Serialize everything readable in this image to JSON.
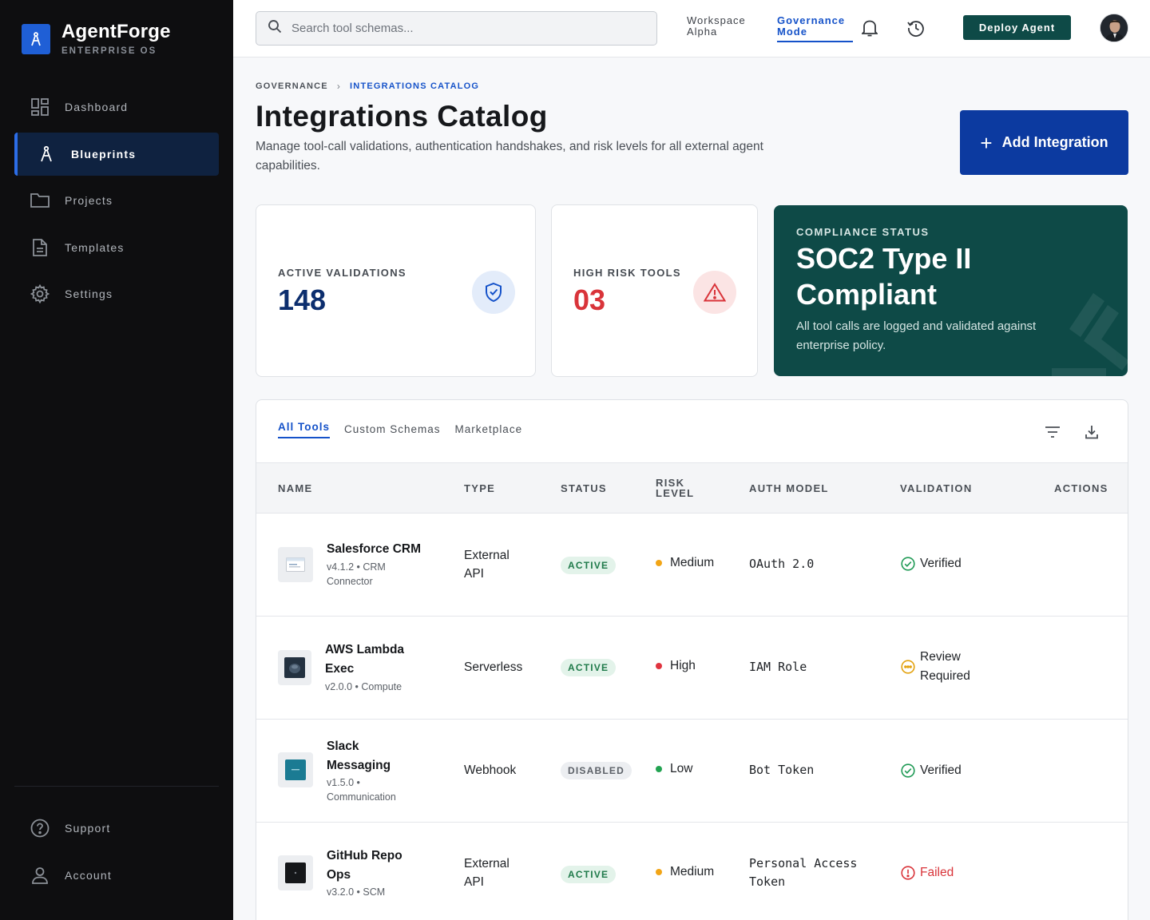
{
  "brand": {
    "name": "AgentForge",
    "subtitle": "ENTERPRISE OS"
  },
  "sidebar": {
    "items": [
      {
        "label": "Dashboard",
        "icon": "dashboard-grid-icon",
        "active": false
      },
      {
        "label": "Blueprints",
        "icon": "compass-icon",
        "active": true
      },
      {
        "label": "Projects",
        "icon": "folder-icon",
        "active": false
      },
      {
        "label": "Templates",
        "icon": "document-icon",
        "active": false
      },
      {
        "label": "Settings",
        "icon": "gear-icon",
        "active": false
      }
    ],
    "bottom": [
      {
        "label": "Support",
        "icon": "help-circle-icon"
      },
      {
        "label": "Account",
        "icon": "user-icon"
      }
    ]
  },
  "topbar": {
    "search_placeholder": "Search tool schemas...",
    "workspace": "Workspace Alpha",
    "governance": "Governance Mode",
    "deploy_label": "Deploy Agent",
    "icons": [
      "bell-icon",
      "history-icon"
    ]
  },
  "breadcrumb": {
    "parent": "GOVERNANCE",
    "current": "INTEGRATIONS CATALOG"
  },
  "page": {
    "title": "Integrations Catalog",
    "description": "Manage tool-call validations, authentication handshakes, and risk levels for all external agent capabilities.",
    "add_label": "Add Integration"
  },
  "stats": {
    "active_validations": {
      "label": "ACTIVE VALIDATIONS",
      "value": "148"
    },
    "high_risk": {
      "label": "HIGH RISK TOOLS",
      "value": "03"
    },
    "compliance": {
      "label": "COMPLIANCE STATUS",
      "title": "SOC2 Type II Compliant",
      "description": "All tool calls are logged and validated against enterprise policy."
    }
  },
  "tabs": [
    "All Tools",
    "Custom Schemas",
    "Marketplace"
  ],
  "table": {
    "headers": {
      "name": "NAME",
      "type": "TYPE",
      "status": "STATUS",
      "risk": "RISK LEVEL",
      "auth": "AUTH MODEL",
      "validation": "VALIDATION",
      "actions": "ACTIONS"
    },
    "rows": [
      {
        "name": "Salesforce CRM",
        "meta": "v4.1.2 • CRM Connector",
        "type": "External API",
        "status": "ACTIVE",
        "risk": "Medium",
        "auth": "OAuth 2.0",
        "validation": "Verified"
      },
      {
        "name": "AWS Lambda Exec",
        "meta": "v2.0.0 • Compute",
        "type": "Serverless",
        "status": "ACTIVE",
        "risk": "High",
        "auth": "IAM Role",
        "validation": "Review Required"
      },
      {
        "name": "Slack Messaging",
        "meta": "v1.5.0 • Communication",
        "type": "Webhook",
        "status": "DISABLED",
        "risk": "Low",
        "auth": "Bot Token",
        "validation": "Verified"
      },
      {
        "name": "GitHub Repo Ops",
        "meta": "v3.2.0 • SCM",
        "type": "External API",
        "status": "ACTIVE",
        "risk": "Medium",
        "auth": "Personal Access Token",
        "validation": "Failed"
      }
    ]
  },
  "colors": {
    "accent": "#1552c9",
    "primary_button": "#0c3aa0",
    "teal": "#0e4a47",
    "risk_medium": "#f2a516",
    "risk_high": "#e0343f",
    "risk_low": "#22a351",
    "verified": "#1f9a55",
    "review": "#e3a20f",
    "failed": "#d9343a"
  }
}
